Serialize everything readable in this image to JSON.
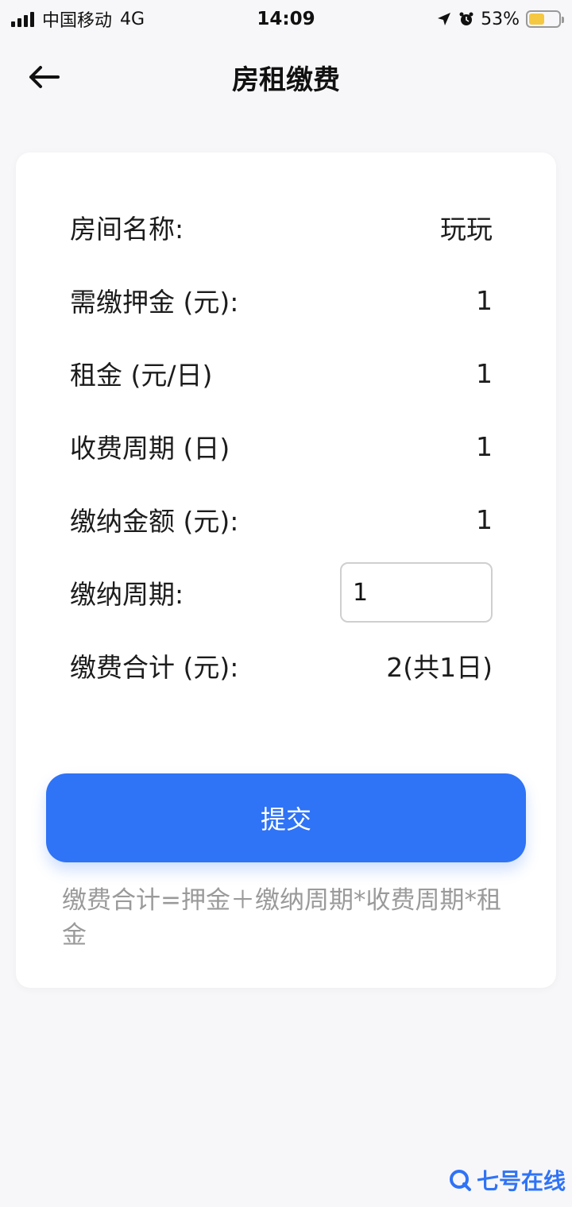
{
  "status_bar": {
    "carrier": "中国移动",
    "network": "4G",
    "time": "14:09",
    "battery": "53%",
    "battery_level": 0.53
  },
  "nav": {
    "title": "房租缴费"
  },
  "details": [
    {
      "label": "房间名称:",
      "value": "玩玩"
    },
    {
      "label": "需缴押金 (元):",
      "value": "1"
    },
    {
      "label": "租金 (元/日)",
      "value": "1"
    },
    {
      "label": "收费周期 (日)",
      "value": "1"
    },
    {
      "label": "缴纳金额 (元):",
      "value": "1"
    }
  ],
  "period_field": {
    "label": "缴纳周期:",
    "value": "1"
  },
  "total": {
    "label": "缴费合计 (元):",
    "value": "2(共1日)"
  },
  "submit_label": "提交",
  "formula_note": "缴费合计=押金＋缴纳周期*收费周期*租金",
  "watermark": "七号在线",
  "colors": {
    "accent": "#2f73f6",
    "background": "#f7f7f9",
    "card": "#ffffff",
    "note": "#9a9a9a"
  }
}
